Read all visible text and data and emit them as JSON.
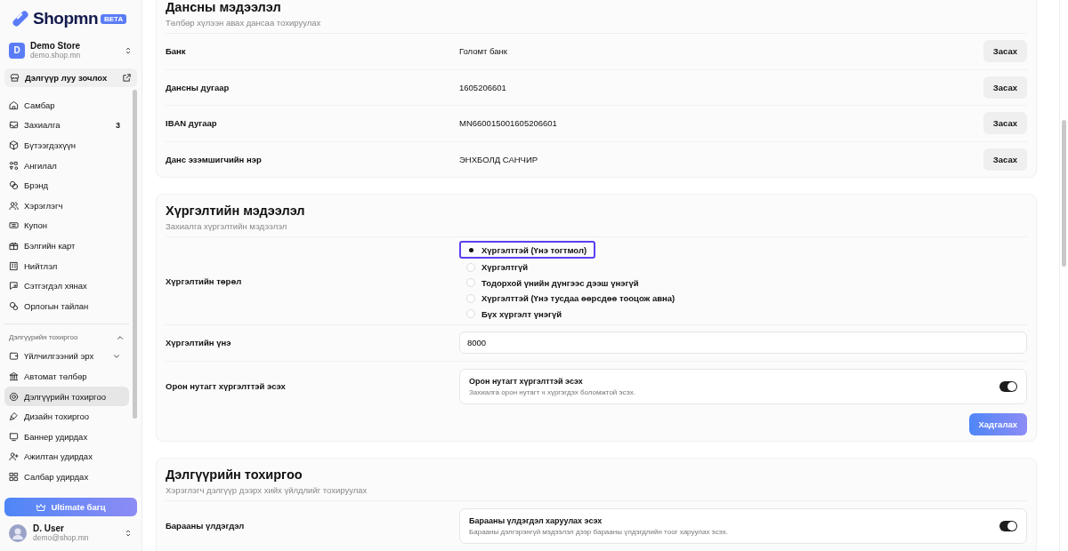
{
  "logo": {
    "text": "Shopmn",
    "badge": "BETA"
  },
  "store": {
    "initial": "D",
    "name": "Demo Store",
    "domain": "demo.shop.mn"
  },
  "visit_store": "Дэлгүүр луу зочлох",
  "nav": [
    {
      "label": "Самбар",
      "selected": false
    },
    {
      "label": "Захиалга",
      "count": "3",
      "selected": false
    },
    {
      "label": "Бүтээгдэхүүн",
      "selected": false
    },
    {
      "label": "Ангилал",
      "selected": false
    },
    {
      "label": "Брэнд",
      "selected": false
    },
    {
      "label": "Хэрэглэгч",
      "selected": false
    },
    {
      "label": "Купон",
      "selected": false
    },
    {
      "label": "Бэлгийн карт",
      "selected": false
    },
    {
      "label": "Нийтлэл",
      "selected": false
    },
    {
      "label": "Сэтгэгдэл хянах",
      "selected": false
    },
    {
      "label": "Орлогын тайлан",
      "selected": false
    }
  ],
  "settings_group": {
    "title": "Дэлгүүрийн тохиргоо",
    "expanded": true,
    "items": [
      {
        "label": "Үйлчилгээний эрх",
        "selected": false,
        "expanded": false
      },
      {
        "label": "Автомат төлбөр",
        "selected": false
      },
      {
        "label": "Дэлгүүрийн тохиргоо",
        "selected": true
      },
      {
        "label": "Дизайн тохиргоо",
        "selected": false
      },
      {
        "label": "Баннер удирдах",
        "selected": false
      },
      {
        "label": "Ажилтан удирдах",
        "selected": false
      },
      {
        "label": "Салбар удирдах",
        "selected": false
      }
    ]
  },
  "upgrade_button": "Ultimate багц",
  "user": {
    "name": "D. User",
    "email": "demo@shop.mn"
  },
  "sections": [
    {
      "kind": "info",
      "title": "Дансны мэдээлэл",
      "subtitle": "Төлбөр хүлээн авах дансаа тохируулах",
      "rows": [
        {
          "label": "Банк",
          "value": "Голомт банк",
          "action": "Засах"
        },
        {
          "label": "Дансны дугаар",
          "value": "1605206601",
          "action": "Засах"
        },
        {
          "label": "IBAN дугаар",
          "value": "MN660015001605206601",
          "action": "Засах"
        },
        {
          "label": "Данс эзэмшигчийн нэр",
          "value": "ЭНХБОЛД САНЧИР",
          "action": "Засах"
        }
      ]
    },
    {
      "kind": "form",
      "title": "Хүргэлтийн мэдээлэл",
      "subtitle": "Захиалга хүргэлтийн мэдээлэл",
      "fields": [
        {
          "kind": "radio",
          "label": "Хүргэлтийн төрөл",
          "options": [
            {
              "label": "Хүргэлттэй (Үнэ тогтмол)",
              "selected": true,
              "focused": true
            },
            {
              "label": "Хүргэлтгүй",
              "selected": false,
              "focused": false
            },
            {
              "label": "Тодорхой үнийн дүнгээс дээш үнэгүй",
              "selected": false,
              "focused": false
            },
            {
              "label": "Хүргэлттэй (Үнэ тусдаа өөрсдөө тооцож авна)",
              "selected": false,
              "focused": false
            },
            {
              "label": "Бүх хүргэлт үнэгүй",
              "selected": false,
              "focused": false
            }
          ]
        },
        {
          "kind": "input",
          "label": "Хүргэлтийн үнэ",
          "value": "8000"
        },
        {
          "kind": "toggle",
          "label": "Орон нутагт хүргэлттэй эсэх",
          "title": "Орон нутагт хүргэлттэй эсэх",
          "description": "Захиалга орон нутагт ч хүргэгдэх боломжтой эсэх.",
          "on": true
        }
      ],
      "save_button": "Хадгалах"
    },
    {
      "kind": "form",
      "title": "Дэлгүүрийн тохиргоо",
      "subtitle": "Хэрэглэгч дэлгүүр дээрх хийх үйлдлийг тохируулах",
      "fields": [
        {
          "kind": "toggle",
          "label": "Барааны үлдэгдэл",
          "title": "Барааны үлдэгдэл харуулах эсэх",
          "description": "Барааны дэлгэрэнгүй мэдээлэл дээр барааны үлдэгдлийн тоог харуулах эсэх.",
          "on": true
        }
      ]
    }
  ]
}
